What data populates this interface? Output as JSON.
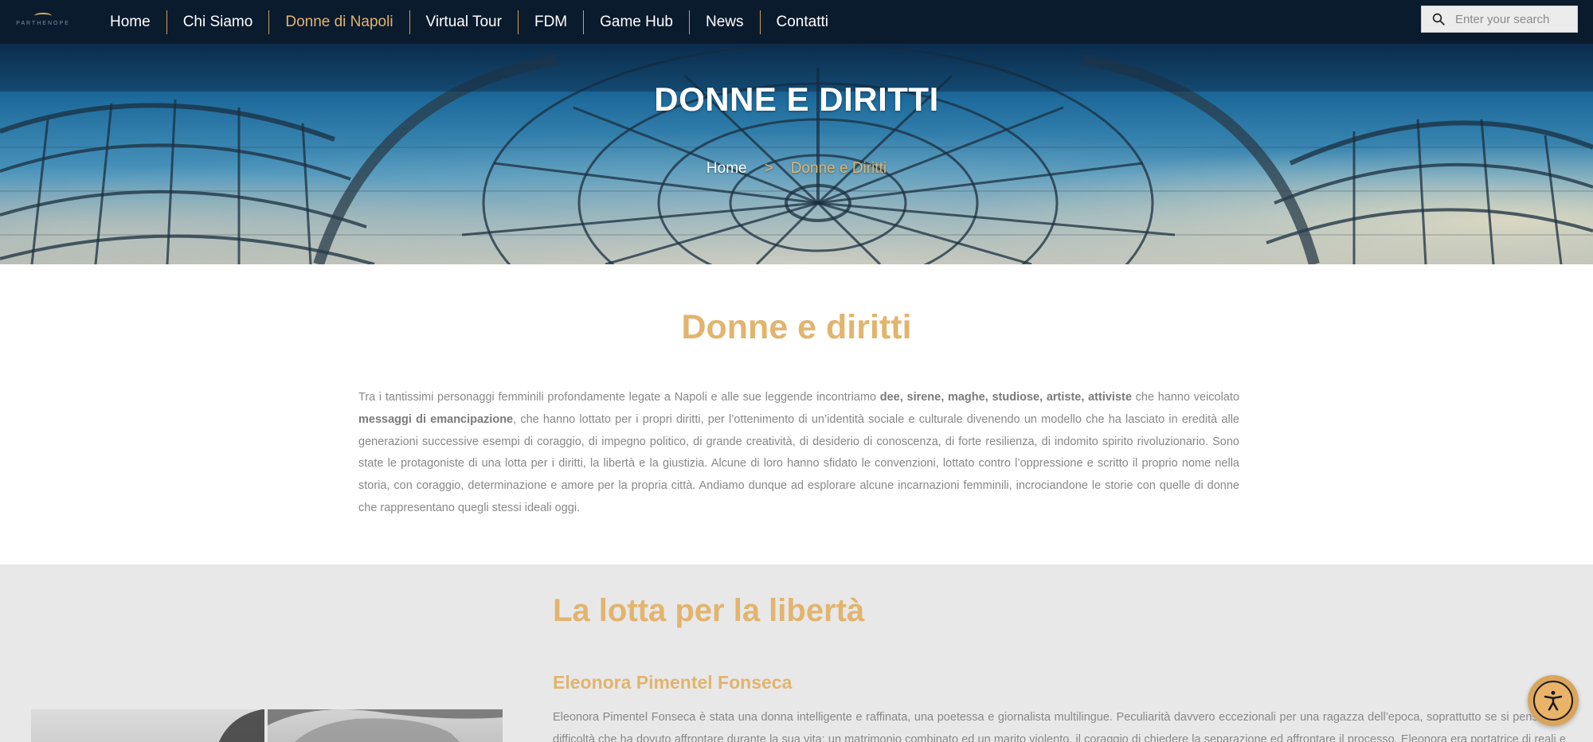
{
  "logo": {
    "text": "PARTHENOPE"
  },
  "nav": {
    "items": [
      {
        "label": "Home"
      },
      {
        "label": "Chi Siamo"
      },
      {
        "label": "Donne di Napoli"
      },
      {
        "label": "Virtual Tour"
      },
      {
        "label": "FDM"
      },
      {
        "label": "Game Hub"
      },
      {
        "label": "News"
      },
      {
        "label": "Contatti"
      }
    ],
    "active": "Donne di Napoli"
  },
  "search": {
    "placeholder": "Enter your search",
    "icon": "search-icon"
  },
  "hero": {
    "title": "DONNE E DIRITTI",
    "breadcrumb": {
      "home": "Home",
      "separator": ">",
      "current": "Donne e Diritti"
    }
  },
  "intro": {
    "title": "Donne e diritti",
    "text_1": "Tra i tantissimi personaggi femminili profondamente legate a Napoli e alle sue leggende incontriamo ",
    "bold_1": "dee, sirene, maghe, studiose, artiste, attiviste",
    "text_2": " che hanno veicolato ",
    "bold_2": "messaggi di emancipazione",
    "text_3": ", che hanno lottato per i propri diritti, per l’ottenimento di un’identità sociale e culturale divenendo un modello che ha lasciato in eredità alle generazioni successive esempi di coraggio, di impegno politico, di grande creatività, di desiderio di conoscenza, di forte resilienza, di indomito spirito rivoluzionario. Sono state le protagoniste di una lotta per i diritti, la libertà e la giustizia. Alcune di loro hanno sfidato le convenzioni, lottato contro l’oppressione e scritto il proprio nome nella storia, con coraggio, determinazione e amore per la propria città. Andiamo dunque ad esplorare alcune incarnazioni femminili, incrociandone le storie con quelle di donne che rappresentano quegli stessi ideali oggi."
  },
  "section": {
    "title": "La lotta per la libertà",
    "subtitle": "Eleonora Pimentel Fonseca",
    "text": "Eleonora Pimentel Fonseca è stata una donna intelligente e raffinata, una poetessa e giornalista multilingue. Peculiarità davvero eccezionali per una ragazza dell’epoca, soprattutto se si pensa alle difficoltà che ha dovuto affrontare durante la sua vita: un matrimonio combinato ed un marito violento, il coraggio di chiedere la separazione ed affrontare il processo. Eleonora era portatrice di reali e concreti ideali"
  },
  "colors": {
    "accent": "#e2b46e",
    "navbar": "#0b1b2e",
    "body_text": "#888888",
    "section_bg": "#e8e8e8"
  },
  "accessibility": {
    "icon": "accessibility-icon"
  }
}
